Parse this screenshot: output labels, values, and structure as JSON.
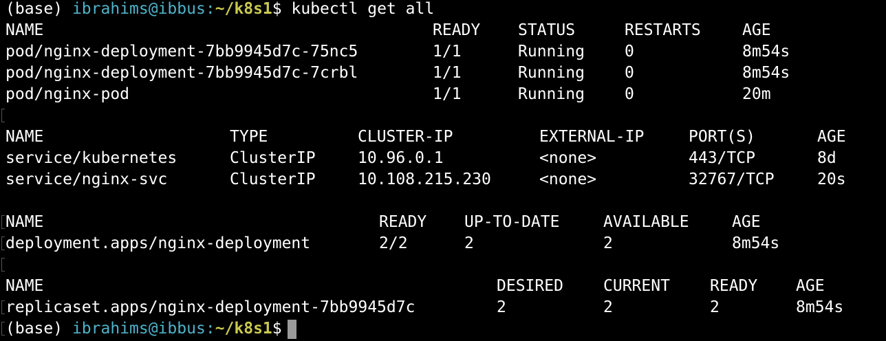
{
  "prompt": {
    "env": "(base)",
    "user_host": "ibrahims@ibbus",
    "sep": ":",
    "path": "~/k8s1",
    "dollar": "$",
    "command": "kubectl get all"
  },
  "pods": {
    "headers": [
      "NAME",
      "READY",
      "STATUS",
      "RESTARTS",
      "AGE"
    ],
    "rows": [
      [
        "pod/nginx-deployment-7bb9945d7c-75nc5",
        "1/1",
        "Running",
        "0",
        "8m54s"
      ],
      [
        "pod/nginx-deployment-7bb9945d7c-7crbl",
        "1/1",
        "Running",
        "0",
        "8m54s"
      ],
      [
        "pod/nginx-pod",
        "1/1",
        "Running",
        "0",
        "20m"
      ]
    ]
  },
  "services": {
    "headers": [
      "NAME",
      "TYPE",
      "CLUSTER-IP",
      "EXTERNAL-IP",
      "PORT(S)",
      "AGE"
    ],
    "rows": [
      [
        "service/kubernetes",
        "ClusterIP",
        "10.96.0.1",
        "<none>",
        "443/TCP",
        "8d"
      ],
      [
        "service/nginx-svc",
        "ClusterIP",
        "10.108.215.230",
        "<none>",
        "32767/TCP",
        "20s"
      ]
    ]
  },
  "deployments": {
    "headers": [
      "NAME",
      "READY",
      "UP-TO-DATE",
      "AVAILABLE",
      "AGE"
    ],
    "rows": [
      [
        "deployment.apps/nginx-deployment",
        "2/2",
        "2",
        "2",
        "8m54s"
      ]
    ]
  },
  "replicasets": {
    "headers": [
      "NAME",
      "DESIRED",
      "CURRENT",
      "READY",
      "AGE"
    ],
    "rows": [
      [
        "replicaset.apps/nginx-deployment-7bb9945d7c",
        "2",
        "2",
        "2",
        "8m54s"
      ]
    ]
  },
  "colors": {
    "background": "#000000",
    "text": "#ffffff",
    "user_host": "#4fb3c9",
    "path": "#c9c94f",
    "cursor": "#9a9a9a"
  }
}
